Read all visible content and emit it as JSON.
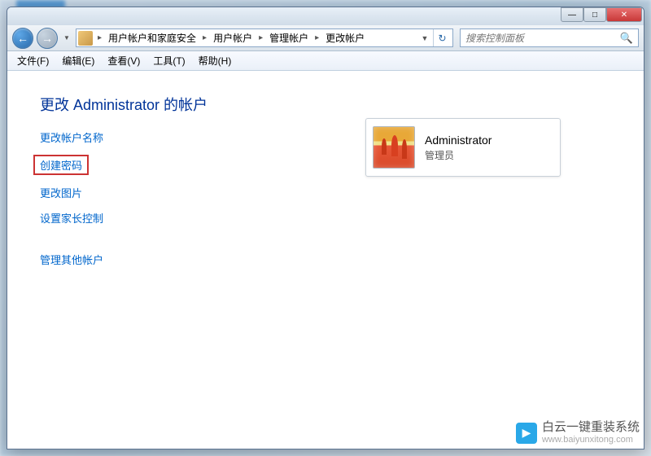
{
  "titlebar": {
    "min": "—",
    "max": "□",
    "close": "✕"
  },
  "nav": {
    "back": "←",
    "forward": "→",
    "dropdown": "▼",
    "refresh": "↻"
  },
  "breadcrumb": {
    "items": [
      "用户帐户和家庭安全",
      "用户帐户",
      "管理帐户",
      "更改帐户"
    ]
  },
  "search": {
    "placeholder": "搜索控制面板",
    "icon": "🔍"
  },
  "menu": {
    "items": [
      "文件(F)",
      "编辑(E)",
      "查看(V)",
      "工具(T)",
      "帮助(H)"
    ]
  },
  "content": {
    "heading": "更改 Administrator 的帐户",
    "links": {
      "change_name": "更改帐户名称",
      "create_password": "创建密码",
      "change_picture": "更改图片",
      "parental_controls": "设置家长控制",
      "manage_other": "管理其他帐户"
    },
    "account": {
      "name": "Administrator",
      "role": "管理员"
    }
  },
  "watermark": {
    "brand": "白云一键重装系统",
    "url": "www.baiyunxitong.com",
    "logo": "▶"
  }
}
